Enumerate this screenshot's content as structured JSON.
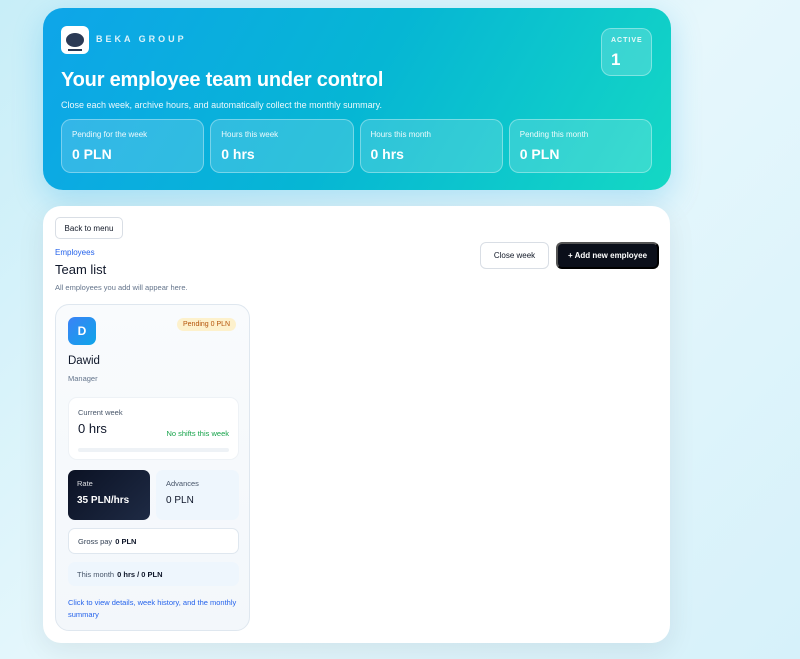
{
  "header": {
    "brand": "BEKA GROUP",
    "title": "Your employee team under control",
    "subtitle": "Close each week, archive hours, and automatically collect the monthly summary.",
    "active": {
      "label": "ACTIVE",
      "value": "1"
    },
    "stats": [
      {
        "label": "Pending for the week",
        "value": "0 PLN"
      },
      {
        "label": "Hours this week",
        "value": "0 hrs"
      },
      {
        "label": "Hours this month",
        "value": "0 hrs"
      },
      {
        "label": "Pending this month",
        "value": "0 PLN"
      }
    ]
  },
  "main": {
    "back_label": "Back to menu",
    "breadcrumb": "Employees",
    "title": "Team list",
    "subtitle": "All employees you add will appear here.",
    "close_week_label": "Close week",
    "add_employee_label": "+ Add new employee"
  },
  "employees": [
    {
      "initial": "D",
      "name": "Dawid",
      "role": "Manager",
      "badge": "Pending 0 PLN",
      "week_label": "Current week",
      "week_value": "0 hrs",
      "week_status": "No shifts this week",
      "week_progress": 0,
      "rate_label": "Rate",
      "rate_value": "35 PLN/hrs",
      "advances_label": "Advances",
      "advances_value": "0 PLN",
      "gross_label": "Gross pay",
      "gross_value": "0 PLN",
      "month_label": "This month",
      "month_value": "0 hrs / 0 PLN",
      "hint": "Click to view details, week history, and the monthly summary"
    }
  ],
  "colors": {
    "accent_start": "#0ea5e9",
    "accent_end": "#14d8c4",
    "primary_button": "#0b0f1a",
    "link": "#2563eb",
    "success": "#16a34a",
    "badge_bg": "#fdf1cc",
    "badge_text": "#b45309"
  },
  "icons": {
    "logo": "beka-group-logo"
  }
}
